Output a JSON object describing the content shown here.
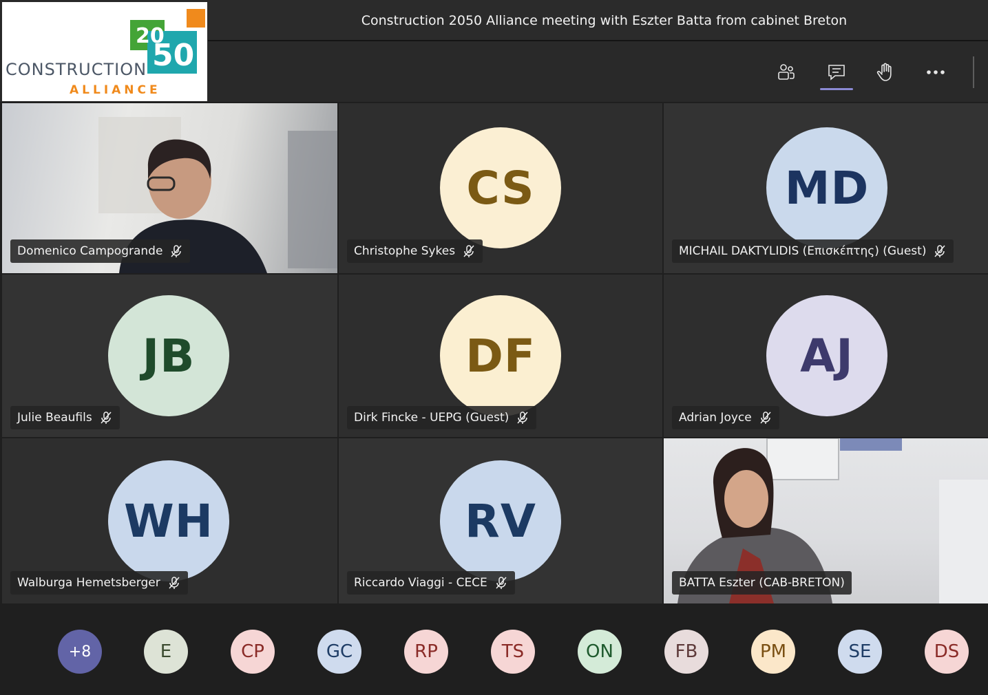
{
  "meeting": {
    "title": "Construction 2050 Alliance meeting with Eszter Batta from cabinet Breton"
  },
  "logo": {
    "num_top": "20",
    "num_bottom": "50",
    "word_top": "CONSTRUCTION",
    "word_bottom": "ALLIANCE"
  },
  "toolbar": {
    "items": [
      {
        "icon": "participants-icon"
      },
      {
        "icon": "chat-icon",
        "active": true
      },
      {
        "icon": "raise-hand-icon"
      },
      {
        "icon": "more-options-icon"
      }
    ]
  },
  "participants": [
    {
      "name": "Domenico Campogrande",
      "video": true,
      "muted": true
    },
    {
      "name": "Christophe Sykes",
      "initials": "CS",
      "bg": "#fbefd3",
      "fg": "#7b5a14",
      "muted": true
    },
    {
      "name": "MICHAIL DAKTYLIDIS (Επισκέπτης) (Guest)",
      "initials": "MD",
      "bg": "#cad9ec",
      "fg": "#1c3460",
      "muted": true
    },
    {
      "name": "Julie Beaufils",
      "initials": "JB",
      "bg": "#d3e5d7",
      "fg": "#1f4b2b",
      "muted": true
    },
    {
      "name": "Dirk Fincke - UEPG (Guest)",
      "initials": "DF",
      "bg": "#fbefd1",
      "fg": "#7b5a14",
      "muted": true
    },
    {
      "name": "Adrian Joyce",
      "initials": "AJ",
      "bg": "#dddbed",
      "fg": "#3d3a6c",
      "muted": true
    },
    {
      "name": "Walburga Hemetsberger",
      "initials": "WH",
      "bg": "#c9d8ec",
      "fg": "#1c3a63",
      "muted": true
    },
    {
      "name": "Riccardo Viaggi - CECE",
      "initials": "RV",
      "bg": "#c9d8ec",
      "fg": "#1c3a63",
      "muted": true
    },
    {
      "name": "BATTA Eszter (CAB-BRETON)",
      "video": true,
      "muted": false
    }
  ],
  "overflow": [
    {
      "initials": "+8",
      "bg": "#6264a7",
      "fg": "#ffffff"
    },
    {
      "initials": "E",
      "bg": "#dde3d6",
      "fg": "#3a4a2f"
    },
    {
      "initials": "CP",
      "bg": "#f6d6d5",
      "fg": "#8a2b27"
    },
    {
      "initials": "GC",
      "bg": "#cfdbee",
      "fg": "#1f3d66"
    },
    {
      "initials": "RP",
      "bg": "#f6d6d5",
      "fg": "#8a2b27"
    },
    {
      "initials": "TS",
      "bg": "#f6d6d5",
      "fg": "#8a2b27"
    },
    {
      "initials": "ON",
      "bg": "#d4ebd8",
      "fg": "#1f5a2e"
    },
    {
      "initials": "FB",
      "bg": "#e8dcdc",
      "fg": "#5e3a3a"
    },
    {
      "initials": "PM",
      "bg": "#fbe7c9",
      "fg": "#7a4f12"
    },
    {
      "initials": "SE",
      "bg": "#cfdbee",
      "fg": "#1f3d66"
    },
    {
      "initials": "DS",
      "bg": "#f6d6d5",
      "fg": "#8a2b27"
    }
  ]
}
